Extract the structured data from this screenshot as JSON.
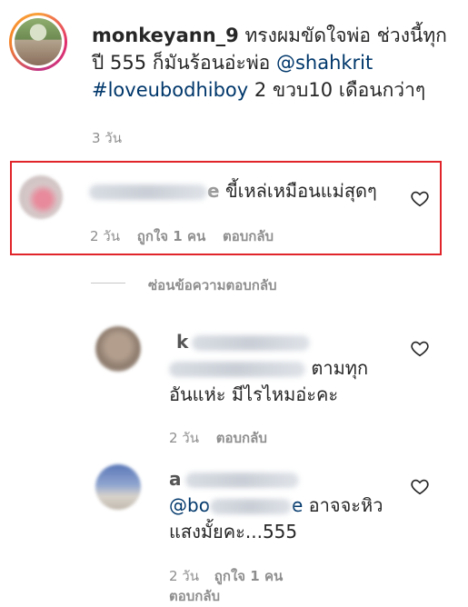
{
  "post": {
    "username": "monkeyann_9",
    "caption_text": " ทรงผมขัดใจพ่อ ช่วงนี้ทุกปี 555 ก็มันร้อนอ่ะพ่อ ",
    "mention": "@shahkrit",
    "hashtag": "#loveubodhiboy",
    "caption_tail": " 2 ขวบ10 เดือนกว่าๆ",
    "time": "3 วัน"
  },
  "comments": [
    {
      "username_visible": "e",
      "text": "ขี้เหล่เหมือนแม่สุดๆ",
      "time": "2 วัน",
      "likes": "ถูกใจ 1 คน",
      "reply": "ตอบกลับ"
    }
  ],
  "hide_replies": "ซ่อนข้อความตอบกลับ",
  "replies": [
    {
      "username_visible": "k",
      "text_line1": "ตามทุก",
      "text_line2": "อันแห่ะ มีไรไหมอ่ะคะ",
      "time": "2 วัน",
      "reply": "ตอบกลับ"
    },
    {
      "username_visible": "a",
      "mention_visible": "@bo",
      "mention_tail": "e",
      "text_line1": " อาจจะหิว",
      "text_line2": "แสงมั้ยคะ...555",
      "time": "2 วัน",
      "likes": "ถูกใจ 1 คน",
      "reply": "ตอบกลับ"
    }
  ],
  "colors": {
    "link": "#00376b",
    "meta": "#8e8e8e",
    "highlight_border": "#e0242a"
  },
  "icons": [
    "heart-icon"
  ]
}
